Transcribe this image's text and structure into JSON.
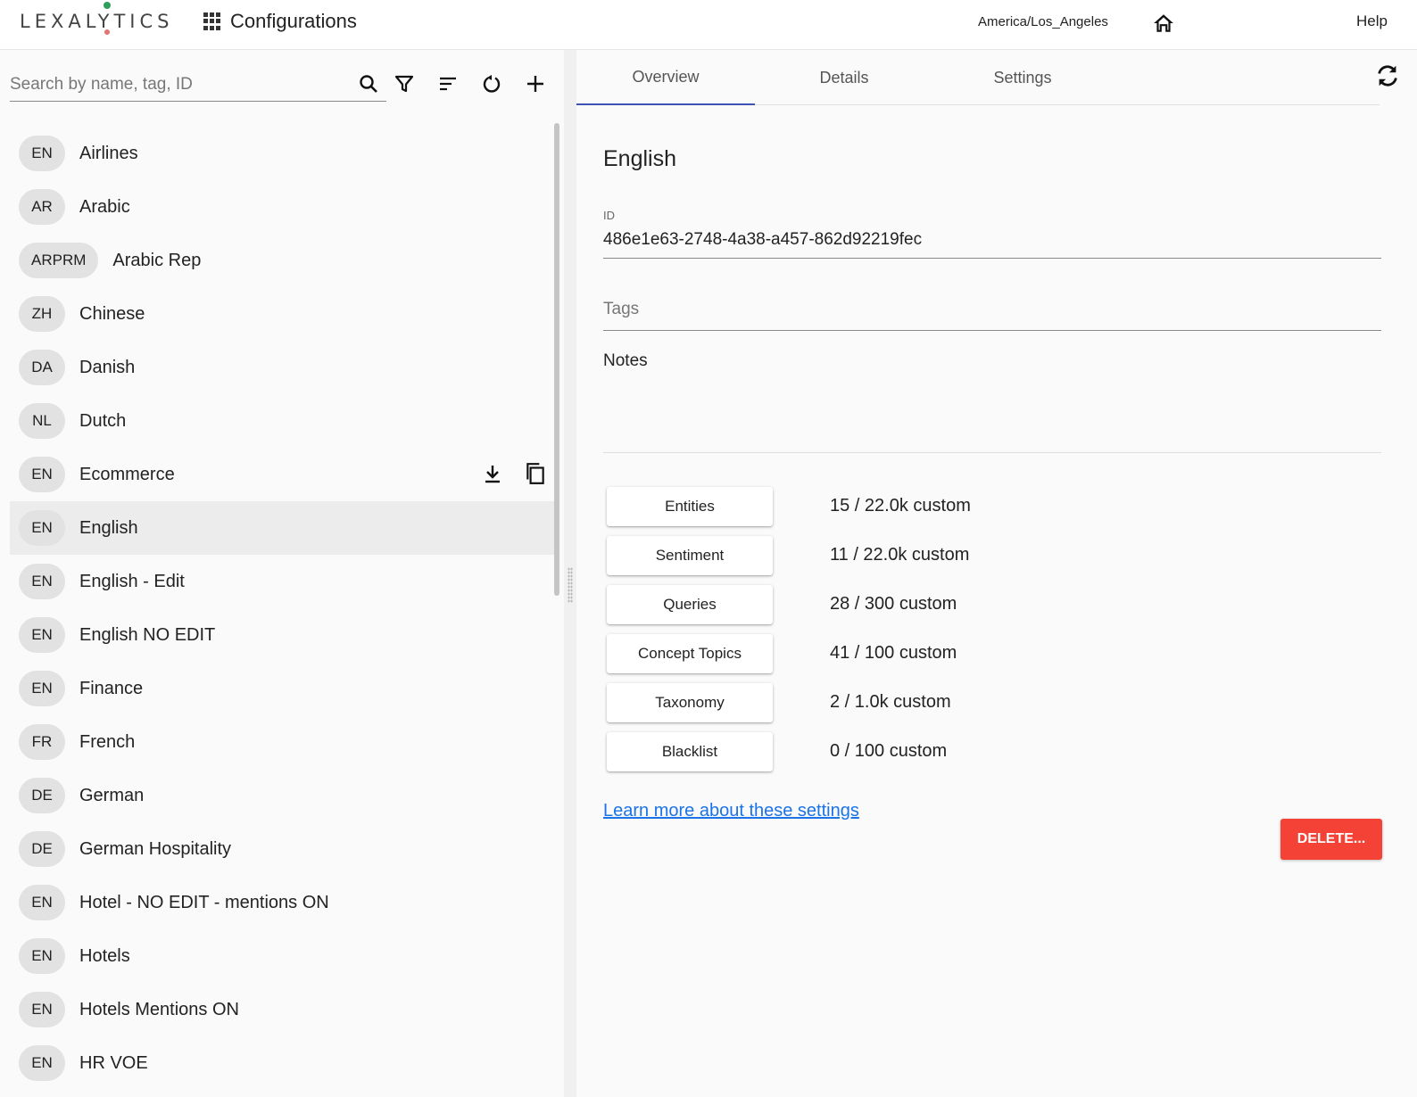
{
  "header": {
    "logo": "LEXALYTICS",
    "app_title": "Configurations",
    "timezone": "America/Los_Angeles",
    "help": "Help"
  },
  "search": {
    "placeholder": "Search by name, tag, ID",
    "value": ""
  },
  "configurations": [
    {
      "lang": "EN",
      "name": "Airlines"
    },
    {
      "lang": "AR",
      "name": "Arabic"
    },
    {
      "lang": "ARPRM",
      "name": "Arabic Rep"
    },
    {
      "lang": "ZH",
      "name": "Chinese"
    },
    {
      "lang": "DA",
      "name": "Danish"
    },
    {
      "lang": "NL",
      "name": "Dutch"
    },
    {
      "lang": "EN",
      "name": "Ecommerce"
    },
    {
      "lang": "EN",
      "name": "English"
    },
    {
      "lang": "EN",
      "name": "English - Edit"
    },
    {
      "lang": "EN",
      "name": "English NO EDIT"
    },
    {
      "lang": "EN",
      "name": "Finance"
    },
    {
      "lang": "FR",
      "name": "French"
    },
    {
      "lang": "DE",
      "name": "German"
    },
    {
      "lang": "DE",
      "name": "German Hospitality"
    },
    {
      "lang": "EN",
      "name": "Hotel - NO EDIT - mentions ON"
    },
    {
      "lang": "EN",
      "name": "Hotels"
    },
    {
      "lang": "EN",
      "name": "Hotels Mentions ON"
    },
    {
      "lang": "EN",
      "name": "HR VOE"
    }
  ],
  "tabs": [
    "Overview",
    "Details",
    "Settings"
  ],
  "active_tab": "Overview",
  "detail": {
    "name": "English",
    "id_label": "ID",
    "id_value": "486e1e63-2748-4a38-a457-862d92219fec",
    "tags_placeholder": "Tags",
    "notes_label": "Notes",
    "stats": [
      {
        "label": "Entities",
        "value": "15 / 22.0k custom"
      },
      {
        "label": "Sentiment",
        "value": "11 / 22.0k custom"
      },
      {
        "label": "Queries",
        "value": "28 / 300 custom"
      },
      {
        "label": "Concept Topics",
        "value": "41 / 100 custom"
      },
      {
        "label": "Taxonomy",
        "value": "2 / 1.0k custom"
      },
      {
        "label": "Blacklist",
        "value": "0 / 100 custom"
      }
    ],
    "learn_more": "Learn more about these settings",
    "delete_label": "DELETE..."
  },
  "colors": {
    "accent": "#3f51b5",
    "danger": "#f44336",
    "link": "#1a73e8",
    "logo_dot": "#2e9e5b"
  }
}
